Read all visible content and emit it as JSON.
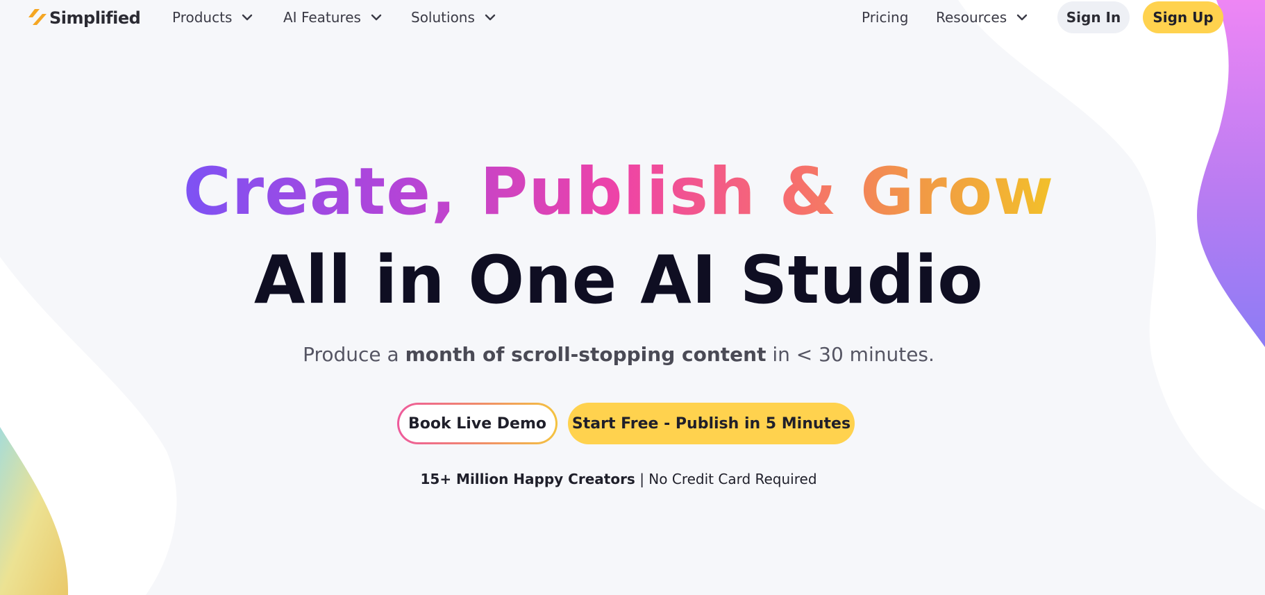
{
  "brand": {
    "name": "Simplified",
    "logo_icon": "simplified-s-logo",
    "accent": "#ffd24e"
  },
  "nav": {
    "left_items": [
      {
        "label": "Products",
        "icon": "chevron-down-icon"
      },
      {
        "label": "AI Features",
        "icon": "chevron-down-icon"
      },
      {
        "label": "Solutions",
        "icon": "chevron-down-icon"
      }
    ],
    "right_items": [
      {
        "label": "Pricing"
      },
      {
        "label": "Resources",
        "icon": "chevron-down-icon"
      }
    ],
    "sign_in": "Sign In",
    "sign_up": "Sign Up"
  },
  "hero": {
    "headline_gradient": "Create, Publish & Grow",
    "headline_main": "All in One AI Studio",
    "sub_prefix": "Produce a ",
    "sub_bold": "month of scroll-stopping content",
    "sub_suffix": " in < 30 minutes.",
    "cta_secondary": "Book Live Demo",
    "cta_primary": "Start Free - Publish in 5 Minutes",
    "trust_bold": "15+ Million Happy Creators",
    "trust_separator": " | ",
    "trust_rest": "No Credit Card Required"
  },
  "colors": {
    "background": "#f6f7fa",
    "headline_dark": "#0f0e22",
    "gradient_stops": [
      "#7d52f4",
      "#ee43a7",
      "#f19a45",
      "#f2c02a"
    ]
  }
}
